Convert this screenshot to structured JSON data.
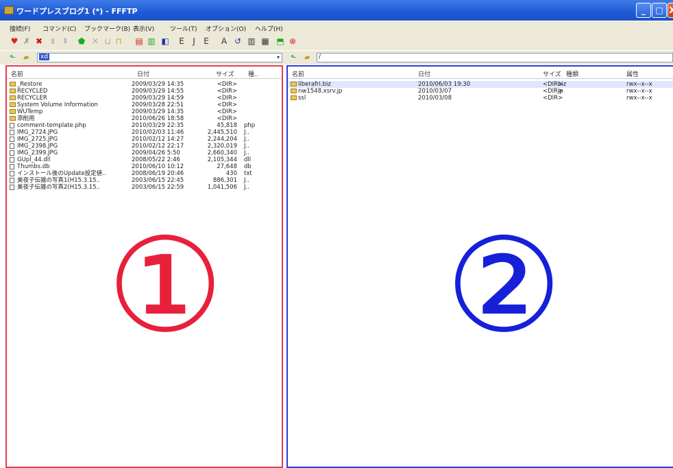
{
  "window": {
    "title": "ワードプレスブログ1 (*) - FFFTP",
    "minimize": "_",
    "maximize": "□",
    "close": "X"
  },
  "menu": [
    "接続(F)",
    "コマンド(C)",
    "ブックマーク(B)",
    "表示(V)",
    "ツール(T)",
    "オプション(O)",
    "ヘルプ(H)"
  ],
  "address": {
    "left_path": "xd",
    "right_path": "/"
  },
  "left_pane": {
    "columns": [
      "名前",
      "日付",
      "サイズ",
      "種.."
    ],
    "rows": [
      {
        "name": "_Restore",
        "date": "2009/03/29 14:35",
        "size": "<DIR>",
        "type": "",
        "icon": "folder"
      },
      {
        "name": "RECYCLED",
        "date": "2009/03/29 14:55",
        "size": "<DIR>",
        "type": "",
        "icon": "folder"
      },
      {
        "name": "RECYCLER",
        "date": "2009/03/29 14:59",
        "size": "<DIR>",
        "type": "",
        "icon": "folder"
      },
      {
        "name": "System Volume Information",
        "date": "2009/03/28 22:51",
        "size": "<DIR>",
        "type": "",
        "icon": "folder"
      },
      {
        "name": "WUTemp",
        "date": "2009/03/29 14:35",
        "size": "<DIR>",
        "type": "",
        "icon": "folder"
      },
      {
        "name": "添削用",
        "date": "2010/06/26 18:58",
        "size": "<DIR>",
        "type": "",
        "icon": "folder"
      },
      {
        "name": "comment-template.php",
        "date": "2010/03/29 22:35",
        "size": "45,818",
        "type": "php",
        "icon": "file"
      },
      {
        "name": "IMG_2724.JPG",
        "date": "2010/02/03 11:46",
        "size": "2,445,510",
        "type": "J..",
        "icon": "file"
      },
      {
        "name": "IMG_2725.JPG",
        "date": "2010/02/12 14:27",
        "size": "2,244,204",
        "type": "J..",
        "icon": "file"
      },
      {
        "name": "IMG_2398.JPG",
        "date": "2010/02/12 22:17",
        "size": "2,320,019",
        "type": "J..",
        "icon": "file"
      },
      {
        "name": "IMG_2399.JPG",
        "date": "2009/04/26 5:50",
        "size": "2,660,340",
        "type": "J..",
        "icon": "file"
      },
      {
        "name": "GUpl_44.dll",
        "date": "2008/05/22 2:46",
        "size": "2,105,344",
        "type": "dll",
        "icon": "file"
      },
      {
        "name": "Thumbs.db",
        "date": "2010/06/10 10:12",
        "size": "27,648",
        "type": "db",
        "icon": "file"
      },
      {
        "name": "インストール後のUpdate設定値..",
        "date": "2008/06/19 20:46",
        "size": "430",
        "type": "txt",
        "icon": "file"
      },
      {
        "name": "美夜子伝雑の写真1(H15.3.15..",
        "date": "2003/06/15 22:45",
        "size": "886,301",
        "type": "J..",
        "icon": "file"
      },
      {
        "name": "美夜子伝雑の写真2(H15.3.15..",
        "date": "2003/06/15 22:59",
        "size": "1,041,506",
        "type": "J..",
        "icon": "file"
      }
    ],
    "marker": "①"
  },
  "right_pane": {
    "columns": [
      "名前",
      "日付",
      "サイズ",
      "種類",
      "属性"
    ],
    "rows": [
      {
        "name": "liberafri.biz",
        "date": "2010/06/03 19:30",
        "size": "<DIR>",
        "type": "biz",
        "attr": "rwx--x--x"
      },
      {
        "name": "nw1548.xsrv.jp",
        "date": "2010/03/07",
        "size": "<DIR>",
        "type": "jp",
        "attr": "rwx--x--x"
      },
      {
        "name": "ssl",
        "date": "2010/03/08",
        "size": "<DIR>",
        "type": "",
        "attr": "rwx--x--x"
      }
    ],
    "marker": "②"
  },
  "colors": {
    "left_border": "#e23c52",
    "right_border": "#2e3cd6",
    "titlebar": "#1f5ad6"
  }
}
